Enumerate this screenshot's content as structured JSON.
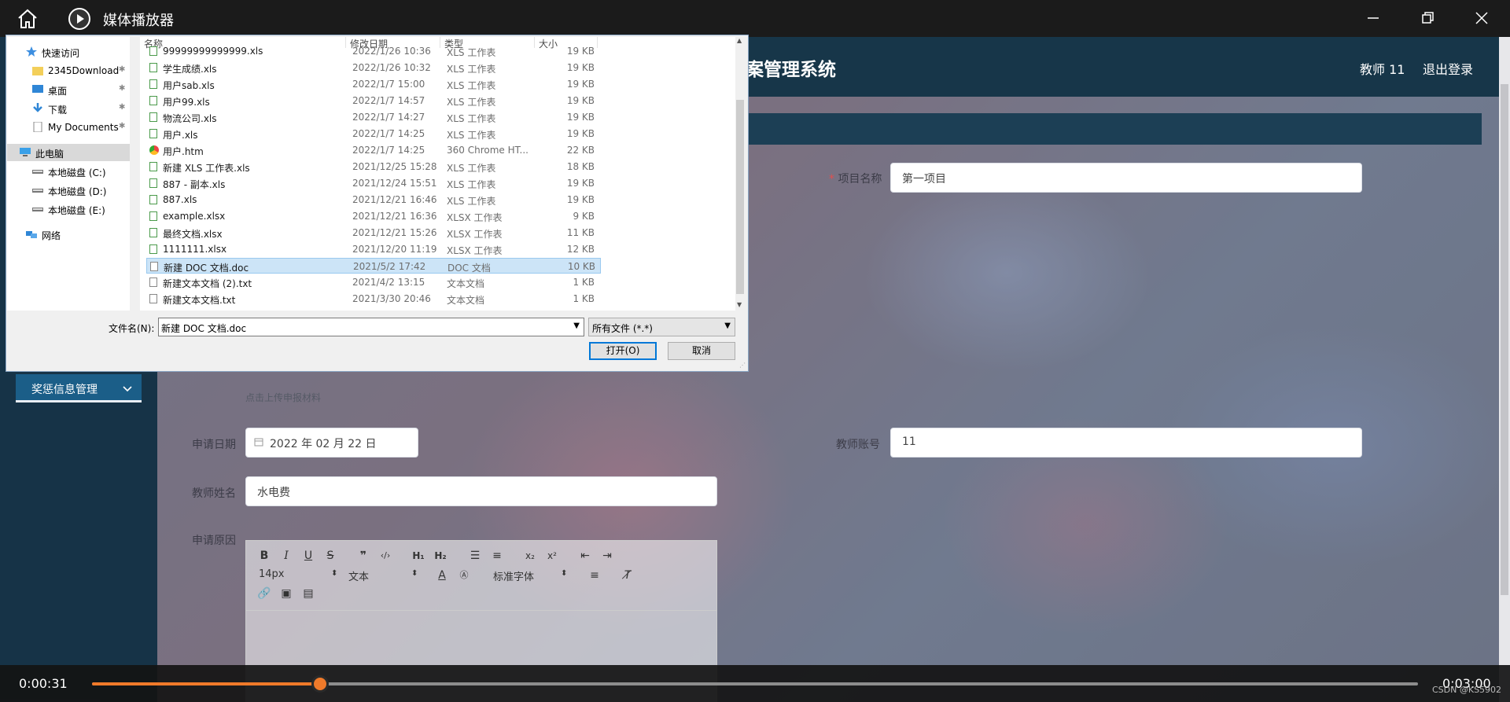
{
  "player": {
    "title": "媒体播放器",
    "current_time": "0:00:31",
    "total_time": "0:03:00",
    "progress": 0.172,
    "watermark": "CSDN @KS5902",
    "accent_color": "#f07a2a"
  },
  "app": {
    "system_title": "案管理系统",
    "user_label": "教师 11",
    "logout_label": "退出登录",
    "menu_item": "奖惩信息管理",
    "form": {
      "project_name_label": "项目名称",
      "project_name_value": "第一项目",
      "upload_tip": "点击上传申报材料",
      "apply_date_label": "申请日期",
      "apply_date_value": "2022 年 02 月 22 日",
      "teacher_account_label": "教师账号",
      "teacher_account_value": "11",
      "teacher_name_label": "教师姓名",
      "teacher_name_value": "水电费",
      "reason_label": "申请原因"
    },
    "editor": {
      "font_size": "14px",
      "text_style": "文本",
      "font_family": "标准字体",
      "toolbar_row1": [
        "B",
        "I",
        "U",
        "S",
        "99",
        "</>",
        "H1",
        "H2",
        "ol",
        "ul",
        "x2",
        "x2"
      ]
    }
  },
  "dialog": {
    "nav": [
      {
        "label": "快速访问",
        "icon": "star-icon",
        "selected": false,
        "pinned": false
      },
      {
        "label": "2345Download",
        "icon": "folder-icon",
        "selected": false,
        "pinned": true
      },
      {
        "label": "桌面",
        "icon": "desktop-icon",
        "selected": false,
        "pinned": true
      },
      {
        "label": "下载",
        "icon": "download-icon",
        "selected": false,
        "pinned": true
      },
      {
        "label": "My Documents",
        "icon": "documents-icon",
        "selected": false,
        "pinned": true
      },
      {
        "label": "此电脑",
        "icon": "computer-icon",
        "selected": true,
        "pinned": false
      },
      {
        "label": "本地磁盘 (C:)",
        "icon": "drive-icon",
        "selected": false,
        "pinned": false
      },
      {
        "label": "本地磁盘 (D:)",
        "icon": "drive-icon",
        "selected": false,
        "pinned": false
      },
      {
        "label": "本地磁盘 (E:)",
        "icon": "drive-icon",
        "selected": false,
        "pinned": false
      },
      {
        "label": "网络",
        "icon": "network-icon",
        "selected": false,
        "pinned": false
      }
    ],
    "columns": [
      "名称",
      "修改日期",
      "类型",
      "大小"
    ],
    "files": [
      {
        "name": "99999999999999.xls",
        "date": "2022/1/26 10:36",
        "type": "XLS 工作表",
        "size": "19 KB",
        "kind": "xls"
      },
      {
        "name": "学生成绩.xls",
        "date": "2022/1/26 10:32",
        "type": "XLS 工作表",
        "size": "19 KB",
        "kind": "xls"
      },
      {
        "name": "用户sab.xls",
        "date": "2022/1/7 15:00",
        "type": "XLS 工作表",
        "size": "19 KB",
        "kind": "xls"
      },
      {
        "name": "用户99.xls",
        "date": "2022/1/7 14:57",
        "type": "XLS 工作表",
        "size": "19 KB",
        "kind": "xls"
      },
      {
        "name": "物流公司.xls",
        "date": "2022/1/7 14:27",
        "type": "XLS 工作表",
        "size": "19 KB",
        "kind": "xls"
      },
      {
        "name": "用户.xls",
        "date": "2022/1/7 14:25",
        "type": "XLS 工作表",
        "size": "19 KB",
        "kind": "xls"
      },
      {
        "name": "用户.htm",
        "date": "2022/1/7 14:25",
        "type": "360 Chrome HT...",
        "size": "22 KB",
        "kind": "htm"
      },
      {
        "name": "新建 XLS 工作表.xls",
        "date": "2021/12/25 15:28",
        "type": "XLS 工作表",
        "size": "18 KB",
        "kind": "xls"
      },
      {
        "name": "887 - 副本.xls",
        "date": "2021/12/24 15:51",
        "type": "XLS 工作表",
        "size": "19 KB",
        "kind": "xls"
      },
      {
        "name": "887.xls",
        "date": "2021/12/21 16:46",
        "type": "XLS 工作表",
        "size": "19 KB",
        "kind": "xls"
      },
      {
        "name": "example.xlsx",
        "date": "2021/12/21 16:36",
        "type": "XLSX 工作表",
        "size": "9 KB",
        "kind": "xls"
      },
      {
        "name": "最终文档.xlsx",
        "date": "2021/12/21 15:26",
        "type": "XLSX 工作表",
        "size": "11 KB",
        "kind": "xls"
      },
      {
        "name": "1111111.xlsx",
        "date": "2021/12/20 11:19",
        "type": "XLSX 工作表",
        "size": "12 KB",
        "kind": "xls"
      },
      {
        "name": "新建 DOC 文档.doc",
        "date": "2021/5/2 17:42",
        "type": "DOC 文档",
        "size": "10 KB",
        "kind": "doc",
        "selected": true
      },
      {
        "name": "新建文本文档 (2).txt",
        "date": "2021/4/2 13:15",
        "type": "文本文档",
        "size": "1 KB",
        "kind": "doc"
      },
      {
        "name": "新建文本文档.txt",
        "date": "2021/3/30 20:46",
        "type": "文本文档",
        "size": "1 KB",
        "kind": "doc"
      }
    ],
    "filename_label": "文件名(N):",
    "filename_value": "新建 DOC 文档.doc",
    "filetype_value": "所有文件 (*.*)",
    "open_label": "打开(O)",
    "cancel_label": "取消"
  }
}
